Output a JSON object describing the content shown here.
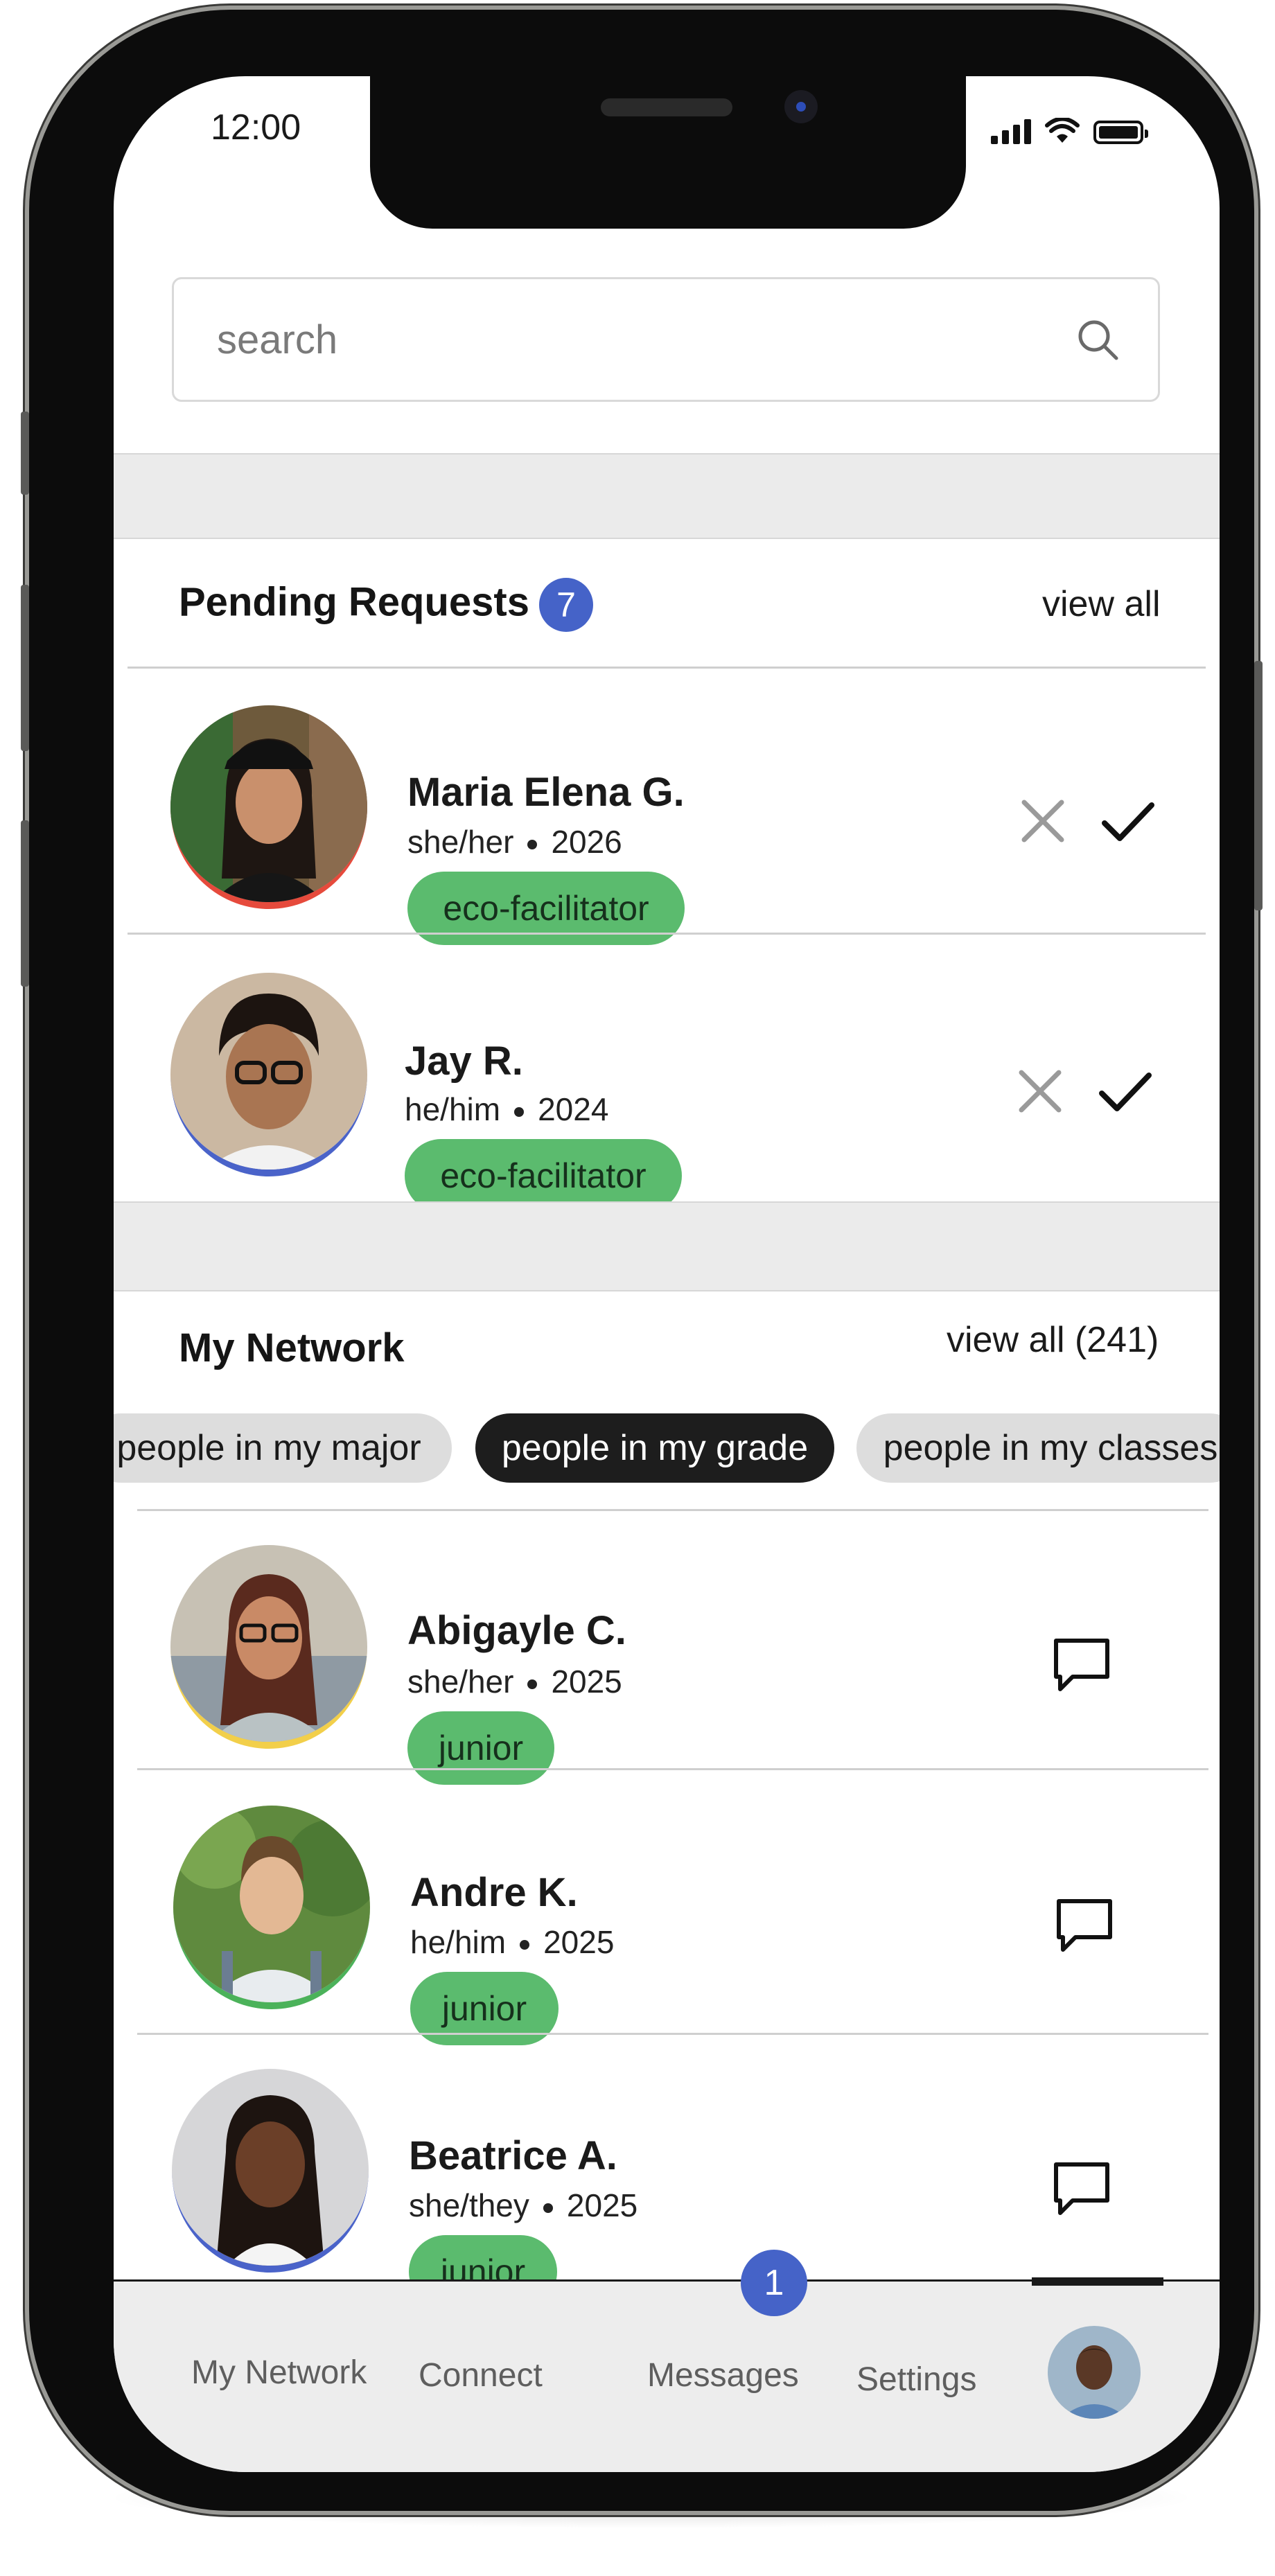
{
  "status_bar": {
    "time": "12:00"
  },
  "search": {
    "placeholder": "search"
  },
  "pending": {
    "title": "Pending Requests",
    "count": "7",
    "view_all": "view all",
    "requests": [
      {
        "name": "Maria Elena G.",
        "pronouns": "she/her",
        "year": "2026",
        "tag": "eco-facilitator",
        "ring_color": "#e64a3c"
      },
      {
        "name": "Jay R.",
        "pronouns": "he/him",
        "year": "2024",
        "tag": "eco-facilitator",
        "ring_color": "#4a63c9"
      }
    ]
  },
  "network": {
    "title": "My Network",
    "view_all": "view all (241)",
    "filters": [
      {
        "label": "people in my major",
        "active": false
      },
      {
        "label": "people in my grade",
        "active": true
      },
      {
        "label": "people in my classes",
        "active": false
      }
    ],
    "people": [
      {
        "name": "Abigayle C.",
        "pronouns": "she/her",
        "year": "2025",
        "tag": "junior",
        "ring_color": "#f2cf4a"
      },
      {
        "name": "Andre K.",
        "pronouns": "he/him",
        "year": "2025",
        "tag": "junior",
        "ring_color": "#4bb25a"
      },
      {
        "name": "Beatrice A.",
        "pronouns": "she/they",
        "year": "2025",
        "tag": "junior",
        "ring_color": "#4a63c9"
      }
    ]
  },
  "tabbar": {
    "tabs": [
      "My Network",
      "Connect",
      "Messages",
      "Settings"
    ],
    "messages_badge": "1",
    "active_tab": "profile"
  },
  "colors": {
    "accent_blue": "#4563c8",
    "tag_green": "#5bbb6e",
    "active_chip": "#1d1d1d"
  }
}
